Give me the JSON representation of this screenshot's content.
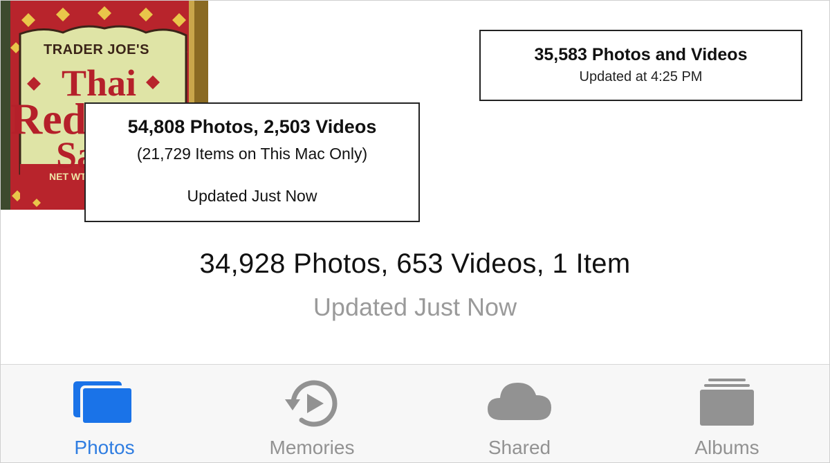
{
  "colors": {
    "accent": "#1a73e8",
    "inactive": "#929292",
    "subtitle_gray": "#9a9a9a"
  },
  "thumbnail": {
    "brand": "TRADER JOE'S",
    "line1": "Thai",
    "line2": "Red C",
    "line3": "Sa",
    "netwt": "NET WT"
  },
  "callouts": {
    "left": {
      "title": "54,808 Photos, 2,503 Videos",
      "subtitle": "(21,729 Items on This Mac Only)",
      "updated": "Updated Just Now"
    },
    "right": {
      "title": "35,583 Photos and Videos",
      "updated": "Updated at 4:25 PM"
    }
  },
  "summary": {
    "count": "34,928 Photos, 653 Videos, 1 Item",
    "updated": "Updated Just Now"
  },
  "tabs": [
    {
      "label": "Photos",
      "icon": "photos-icon",
      "active": true
    },
    {
      "label": "Memories",
      "icon": "memories-icon",
      "active": false
    },
    {
      "label": "Shared",
      "icon": "cloud-icon",
      "active": false
    },
    {
      "label": "Albums",
      "icon": "albums-icon",
      "active": false
    }
  ]
}
